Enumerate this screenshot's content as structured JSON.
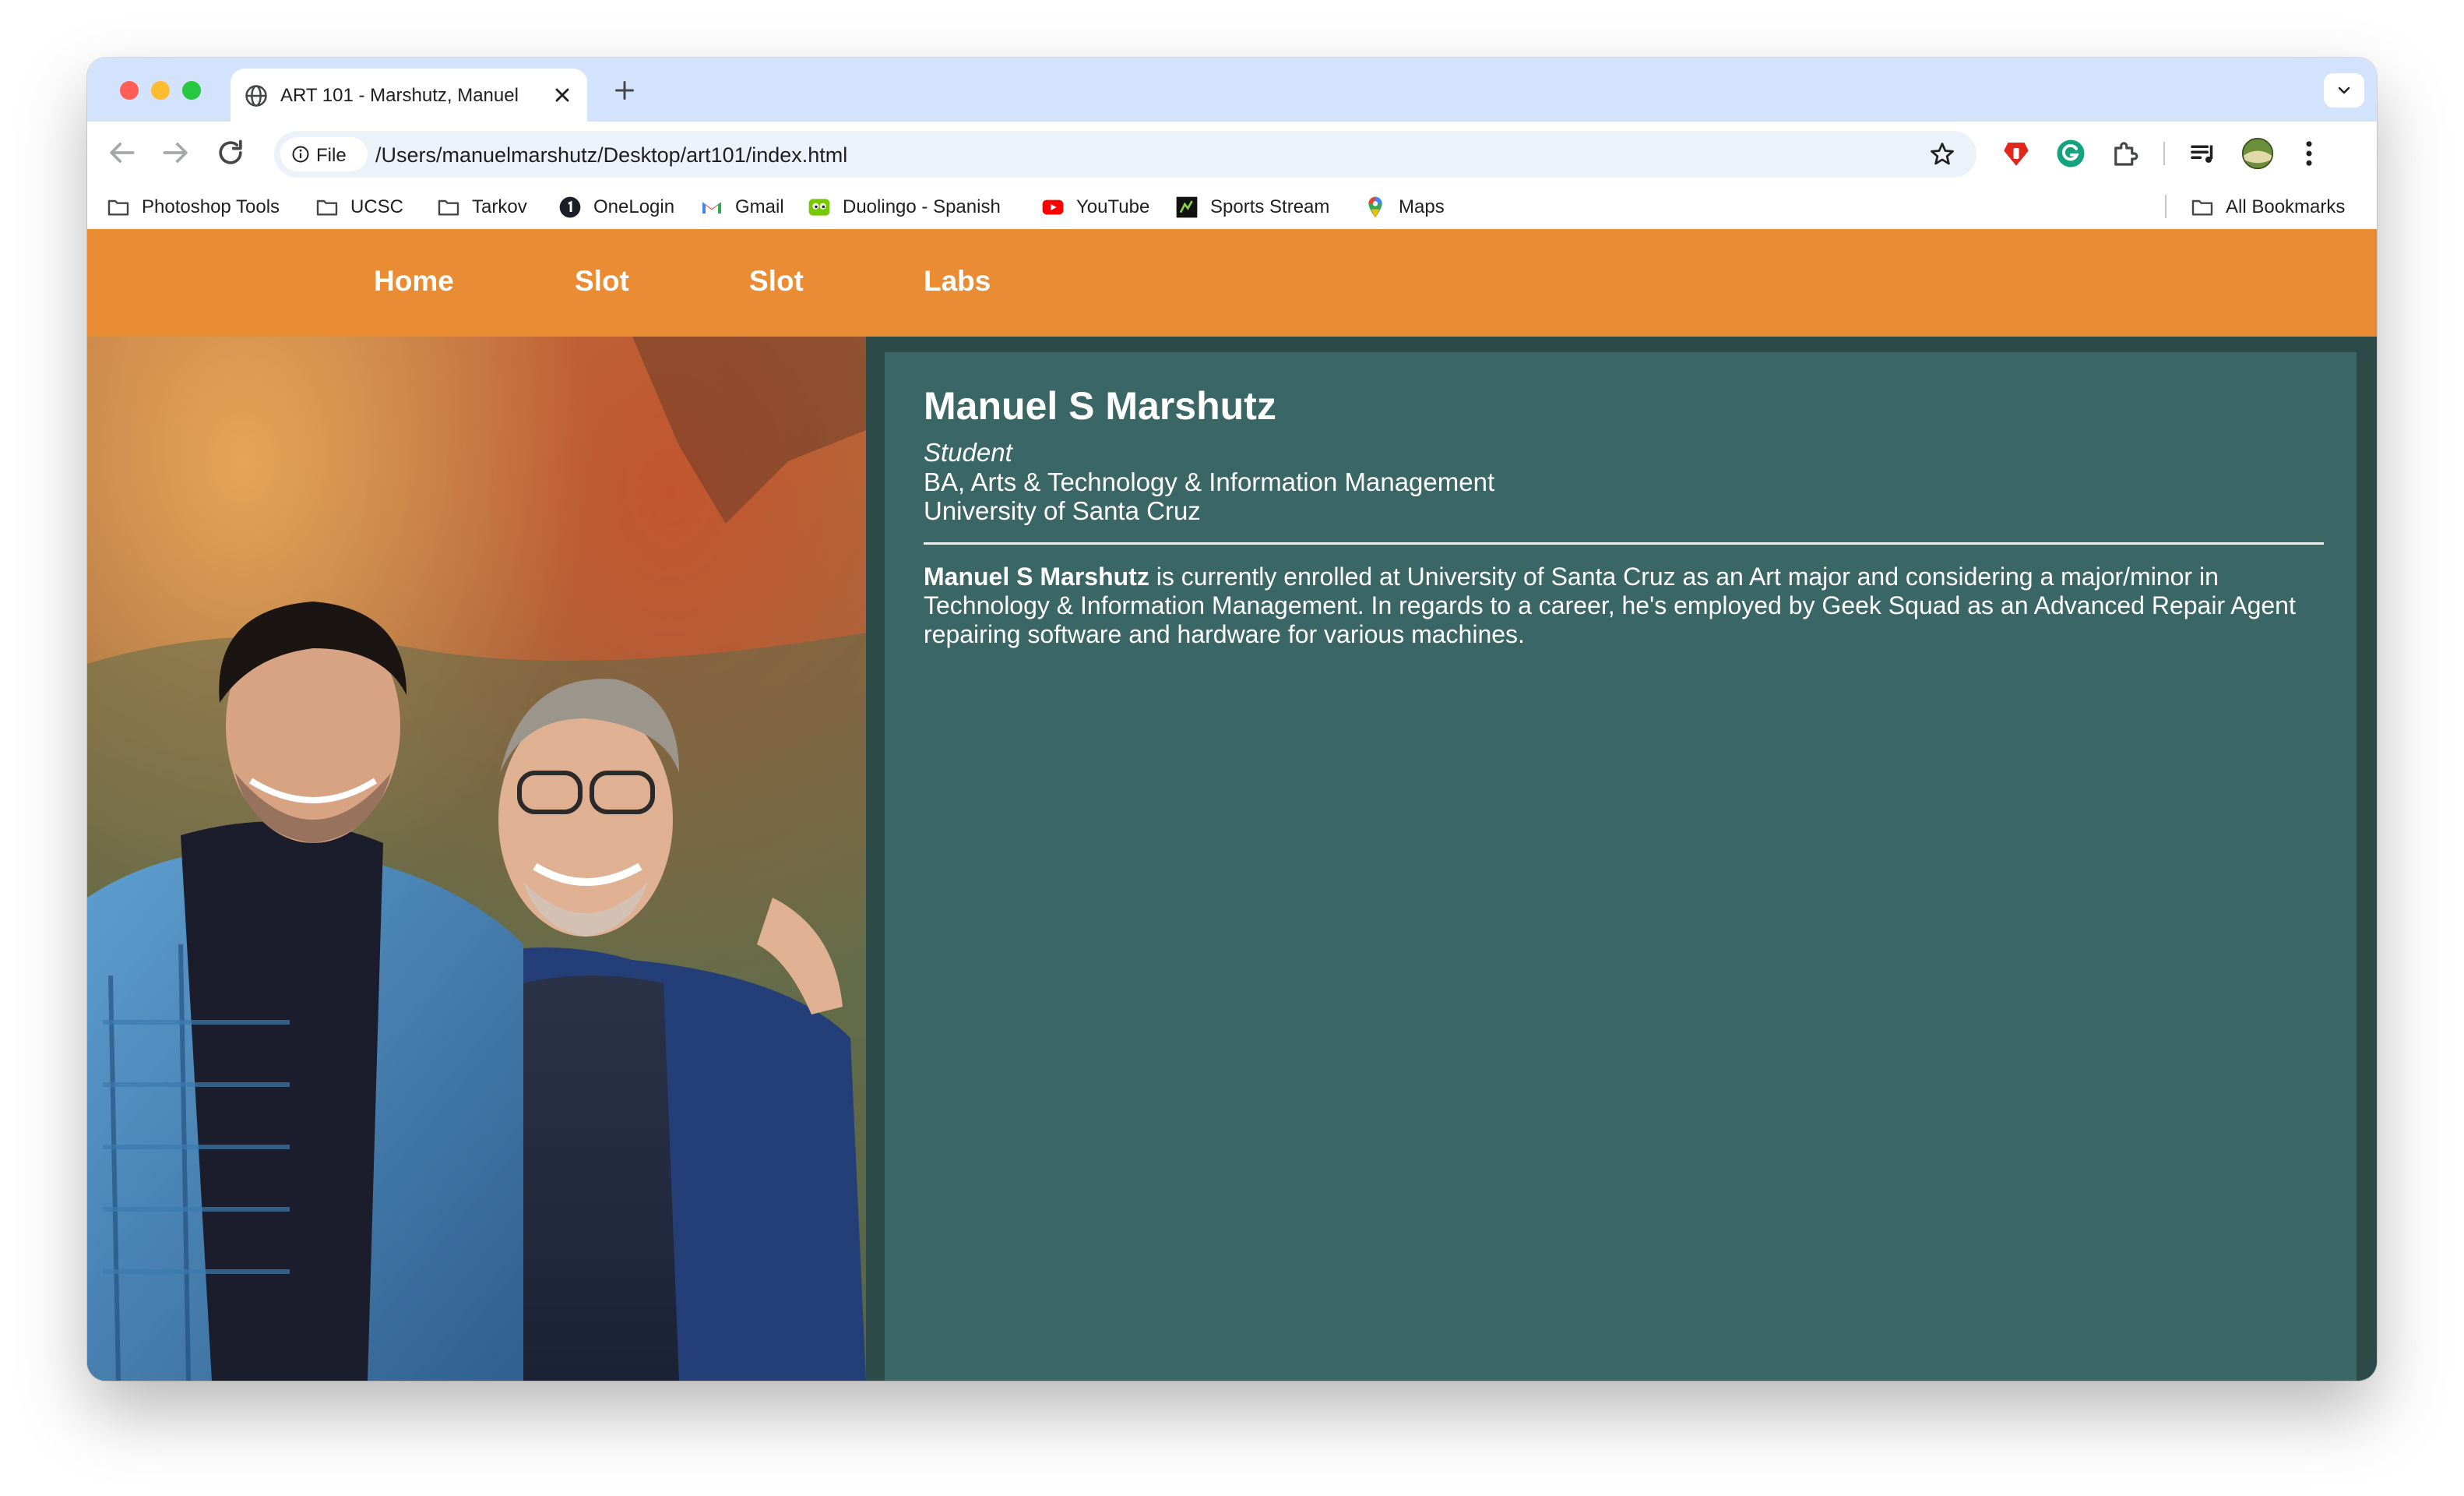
{
  "browser": {
    "tab": {
      "title": "ART 101 - Marshutz, Manuel"
    },
    "address": {
      "scheme_label": "File",
      "url": "/Users/manuelmarshutz/Desktop/art101/index.html"
    },
    "bookmarks": [
      {
        "label": "Photoshop Tools",
        "icon": "folder-icon"
      },
      {
        "label": "UCSC",
        "icon": "folder-icon"
      },
      {
        "label": "Tarkov",
        "icon": "folder-icon"
      },
      {
        "label": "OneLogin",
        "icon": "onelogin-icon"
      },
      {
        "label": "Gmail",
        "icon": "gmail-icon"
      },
      {
        "label": "Duolingo - Spanish",
        "icon": "duolingo-icon"
      },
      {
        "label": "YouTube",
        "icon": "youtube-icon"
      },
      {
        "label": "Sports Stream",
        "icon": "sports-stream-icon"
      },
      {
        "label": "Maps",
        "icon": "maps-icon"
      }
    ],
    "all_bookmarks_label": "All Bookmarks"
  },
  "page": {
    "nav": [
      "Home",
      "Slot",
      "Slot",
      "Labs"
    ],
    "profile": {
      "name": "Manuel S Marshutz",
      "role": "Student",
      "degree": "BA, Arts & Technology & Information Management",
      "school": "University of Santa Cruz"
    },
    "bio": {
      "name_bold": "Manuel S Marshutz",
      "text": " is currently enrolled at University of Santa Cruz as an Art major and considering a major/minor in Technology & Information Management. In regards to a career, he's employed by Geek Squad as an Advanced Repair Agent repairing software and hardware for various machines."
    },
    "colors": {
      "nav_bar": "#e98c33",
      "card": "#3b6666",
      "background": "#2b4a48"
    }
  }
}
